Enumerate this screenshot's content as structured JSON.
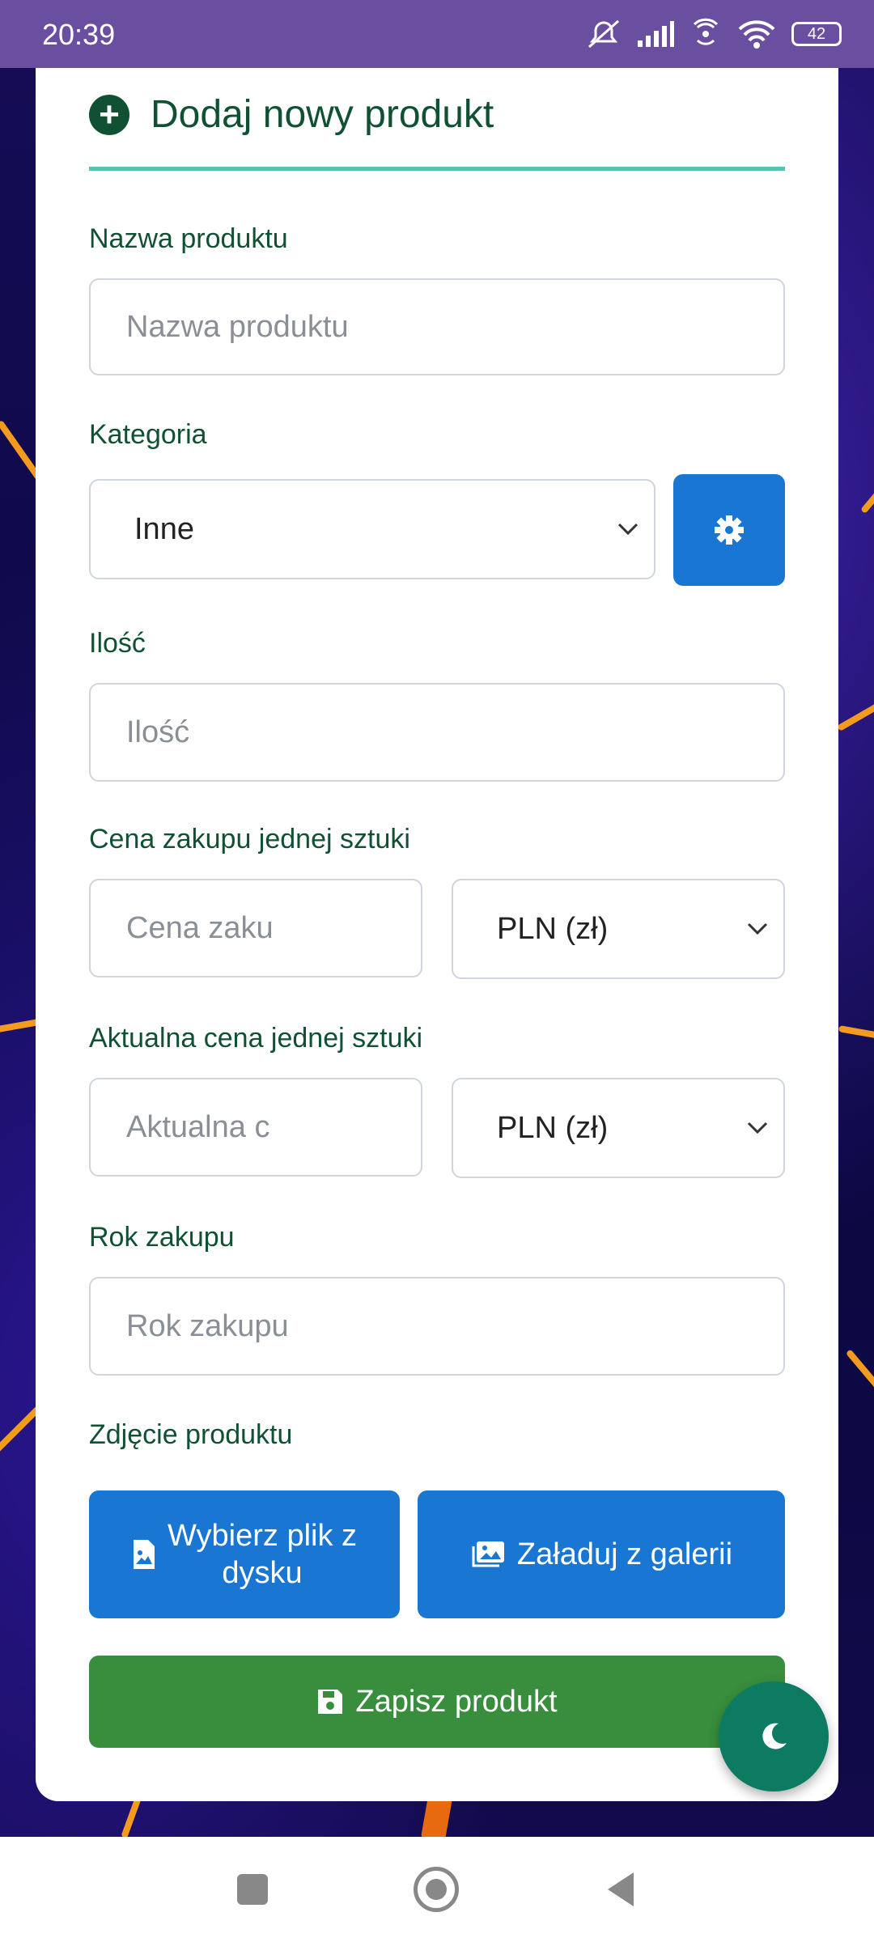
{
  "status_bar": {
    "time": "20:39",
    "battery": "42"
  },
  "header": {
    "title": "Dodaj nowy produkt",
    "icon": "plus-circle-icon"
  },
  "form": {
    "name_label": "Nazwa produktu",
    "name_placeholder": "Nazwa produktu",
    "category_label": "Kategoria",
    "category_value": "Inne",
    "quantity_label": "Ilość",
    "quantity_placeholder": "Ilość",
    "purchase_price_label": "Cena zakupu jednej sztuki",
    "purchase_price_placeholder": "Cena zaku",
    "purchase_currency": "PLN (zł)",
    "current_price_label": "Aktualna cena jednej sztuki",
    "current_price_placeholder": "Aktualna c",
    "current_currency": "PLN (zł)",
    "year_label": "Rok zakupu",
    "year_placeholder": "Rok zakupu",
    "photo_label": "Zdjęcie produktu",
    "choose_file_line1": "Wybierz plik z",
    "choose_file_line2": "dysku",
    "gallery_button": "Załaduj z galerii",
    "save_button": "Zapisz produkt"
  },
  "colors": {
    "accent": "#1976d2",
    "save": "#388e3c",
    "heading": "#0f5132",
    "fab": "#0d7a62",
    "status_bar": "#6a4fa0"
  }
}
